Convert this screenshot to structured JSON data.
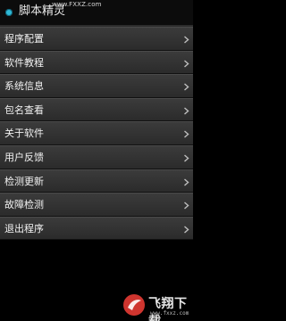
{
  "watermark": "www.FXXZ.com",
  "app": {
    "title": "脚本精灵",
    "icon": "app-dot-icon",
    "icon_color": "#2fb9d6"
  },
  "menu": {
    "items": [
      {
        "label": "程序配置"
      },
      {
        "label": "软件教程"
      },
      {
        "label": "系统信息"
      },
      {
        "label": "包名查看"
      },
      {
        "label": "关于软件"
      },
      {
        "label": "用户反馈"
      },
      {
        "label": "检测更新"
      },
      {
        "label": "故障检测"
      },
      {
        "label": "退出程序"
      }
    ]
  },
  "brand": {
    "name": "飞翔下载",
    "url": "www.fxxz.com",
    "logo_color": "#e53b34"
  }
}
